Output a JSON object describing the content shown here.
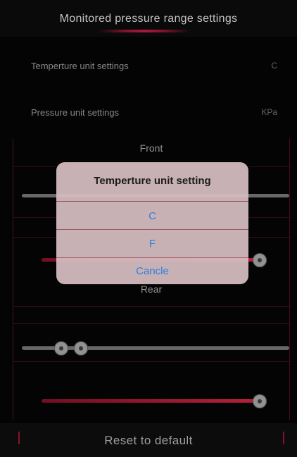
{
  "header": {
    "title": "Monitored pressure range settings"
  },
  "settings": [
    {
      "label": "Temperture unit settings",
      "value": "C"
    },
    {
      "label": "Pressure unit settings",
      "value": "KPa"
    }
  ],
  "panel": {
    "front_label": "Front",
    "rear_label": "Rear"
  },
  "dialog": {
    "title": "Temperture unit setting",
    "options": [
      "C",
      "F",
      "Cancle"
    ]
  },
  "footer": {
    "reset_label": "Reset to default"
  },
  "colors": {
    "accent": "#b01c3e",
    "dialog_link": "#2e7fe0",
    "background": "#050505"
  }
}
